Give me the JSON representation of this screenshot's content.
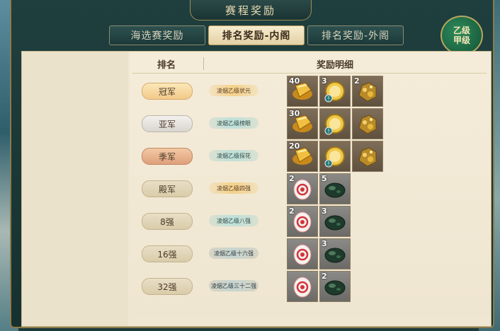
{
  "window": {
    "title": "赛程奖励"
  },
  "tabs": [
    {
      "label": "海选赛奖励",
      "active": false
    },
    {
      "label": "排名奖励-内阁",
      "active": true
    },
    {
      "label": "排名奖励-外阁",
      "active": false
    }
  ],
  "grade_badge": {
    "line1": "乙级",
    "line2": "甲级"
  },
  "table": {
    "header_rank": "排名",
    "header_reward": "奖励明细",
    "rows": [
      {
        "rank": "冠军",
        "style": "gold",
        "title_badge": "凌烟乙级状元",
        "badge_style": "gold",
        "items": [
          {
            "icon": "gold-ingot-stack-icon",
            "qty": "40"
          },
          {
            "icon": "gold-coin-icon",
            "qty": "3"
          },
          {
            "icon": "gold-ore-icon",
            "qty": "2"
          }
        ]
      },
      {
        "rank": "亚军",
        "style": "silver",
        "title_badge": "凌烟乙级榜眼",
        "badge_style": "teal",
        "items": [
          {
            "icon": "gold-ingot-stack-icon",
            "qty": "30"
          },
          {
            "icon": "gold-coin-icon",
            "qty": ""
          },
          {
            "icon": "gold-ore-icon",
            "qty": ""
          }
        ]
      },
      {
        "rank": "季军",
        "style": "bronze",
        "title_badge": "凌烟乙级探花",
        "badge_style": "teal",
        "items": [
          {
            "icon": "gold-ingot-stack-icon",
            "qty": "20"
          },
          {
            "icon": "gold-coin-icon",
            "qty": ""
          },
          {
            "icon": "gold-ore-icon",
            "qty": ""
          }
        ]
      },
      {
        "rank": "殿军",
        "style": "plain",
        "title_badge": "凌烟乙级四强",
        "badge_style": "gold",
        "items": [
          {
            "icon": "swirl-token-icon",
            "qty": "2"
          },
          {
            "icon": "jade-stone-icon",
            "qty": "5"
          }
        ]
      },
      {
        "rank": "8强",
        "style": "plain",
        "title_badge": "凌烟乙级八强",
        "badge_style": "teal",
        "items": [
          {
            "icon": "swirl-token-icon",
            "qty": "2"
          },
          {
            "icon": "jade-stone-icon",
            "qty": "3"
          }
        ]
      },
      {
        "rank": "16强",
        "style": "plain",
        "title_badge": "凌烟乙级十六强",
        "badge_style": "dark",
        "items": [
          {
            "icon": "swirl-token-icon",
            "qty": ""
          },
          {
            "icon": "jade-stone-icon",
            "qty": "3"
          }
        ]
      },
      {
        "rank": "32强",
        "style": "plain",
        "title_badge": "凌烟乙级三十二强",
        "badge_style": "dark",
        "items": [
          {
            "icon": "swirl-token-icon",
            "qty": ""
          },
          {
            "icon": "jade-stone-icon",
            "qty": "2"
          }
        ]
      }
    ]
  }
}
